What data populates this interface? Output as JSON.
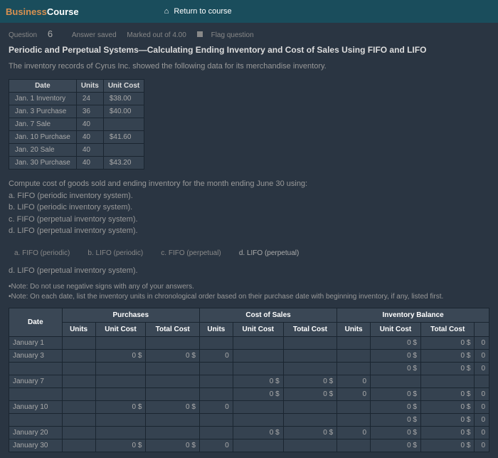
{
  "header": {
    "brand_before": "Business",
    "brand_after": "Course",
    "return": "Return to course"
  },
  "question": {
    "label": "Question",
    "num": "6",
    "saved": "Answer saved",
    "marked": "Marked out of 4.00",
    "flag": "Flag question"
  },
  "title": "Periodic and Perpetual Systems—Calculating Ending Inventory and Cost of Sales Using FIFO and LIFO",
  "desc": "The inventory records of Cyrus Inc. showed the following data for its merchandise inventory.",
  "inv_table": {
    "headers": [
      "Date",
      "Units",
      "Unit Cost"
    ],
    "rows": [
      [
        "Jan. 1 Inventory",
        "24",
        "$38.00"
      ],
      [
        "Jan. 3 Purchase",
        "36",
        "$40.00"
      ],
      [
        "Jan. 7 Sale",
        "40",
        ""
      ],
      [
        "Jan. 10 Purchase",
        "40",
        "$41.60"
      ],
      [
        "Jan. 20 Sale",
        "40",
        ""
      ],
      [
        "Jan. 30 Purchase",
        "40",
        "$43.20"
      ]
    ]
  },
  "compute": {
    "intro": "Compute cost of goods sold and ending inventory for the month ending June 30 using:",
    "a": "a. FIFO (periodic inventory system).",
    "b": "b. LIFO (periodic inventory system).",
    "c": "c. FIFO (perpetual inventory system).",
    "d": "d. LIFO (perpetual inventory system)."
  },
  "tabs": {
    "a": "a. FIFO (periodic)",
    "b": "b. LIFO (periodic)",
    "c": "c. FIFO (perpetual)",
    "d": "d. LIFO (perpetual)"
  },
  "subtab": "d. LIFO (perpetual inventory system).",
  "note1": "•Note: Do not use negative signs with any of your answers.",
  "note2": "•Note: On each date, list the inventory units in chronological order based on their purchase date with beginning inventory, if any, listed first.",
  "main": {
    "grp_purchases": "Purchases",
    "grp_cos": "Cost of Sales",
    "grp_inv": "Inventory Balance",
    "h_date": "Date",
    "h_units": "Units",
    "h_unitcost": "Unit\nCost",
    "h_totalcost": "Total\nCost",
    "rows": [
      {
        "date": "January 1",
        "pu": "",
        "puc": "",
        "ptc": "",
        "cu": "",
        "cuc": "",
        "ctc": "",
        "iu": "",
        "iuc": "0 $",
        "itc": "0 $",
        "end": "0"
      },
      {
        "date": "January 3",
        "pu": "",
        "puc": "0 $",
        "ptc": "0 $",
        "cu": "0",
        "cuc": "",
        "ctc": "",
        "iu": "",
        "iuc": "0 $",
        "itc": "0 $",
        "end": "0"
      },
      {
        "date": "",
        "pu": "",
        "puc": "",
        "ptc": "",
        "cu": "",
        "cuc": "",
        "ctc": "",
        "iu": "",
        "iuc": "0 $",
        "itc": "0 $",
        "end": "0"
      },
      {
        "date": "January 7",
        "pu": "",
        "puc": "",
        "ptc": "",
        "cu": "",
        "cuc": "0 $",
        "ctc": "0 $",
        "iu": "0",
        "iuc": "",
        "itc": "",
        "end": ""
      },
      {
        "date": "",
        "pu": "",
        "puc": "",
        "ptc": "",
        "cu": "",
        "cuc": "0 $",
        "ctc": "0 $",
        "iu": "0",
        "iuc": "0 $",
        "itc": "0 $",
        "end": "0"
      },
      {
        "date": "January 10",
        "pu": "",
        "puc": "0 $",
        "ptc": "0 $",
        "cu": "0",
        "cuc": "",
        "ctc": "",
        "iu": "",
        "iuc": "0 $",
        "itc": "0 $",
        "end": "0"
      },
      {
        "date": "",
        "pu": "",
        "puc": "",
        "ptc": "",
        "cu": "",
        "cuc": "",
        "ctc": "",
        "iu": "",
        "iuc": "0 $",
        "itc": "0 $",
        "end": "0"
      },
      {
        "date": "January 20",
        "pu": "",
        "puc": "",
        "ptc": "",
        "cu": "",
        "cuc": "0 $",
        "ctc": "0 $",
        "iu": "0",
        "iuc": "0 $",
        "itc": "0 $",
        "end": "0"
      },
      {
        "date": "January 30",
        "pu": "",
        "puc": "0 $",
        "ptc": "0 $",
        "cu": "0",
        "cuc": "",
        "ctc": "",
        "iu": "",
        "iuc": "0 $",
        "itc": "0 $",
        "end": "0"
      }
    ]
  }
}
